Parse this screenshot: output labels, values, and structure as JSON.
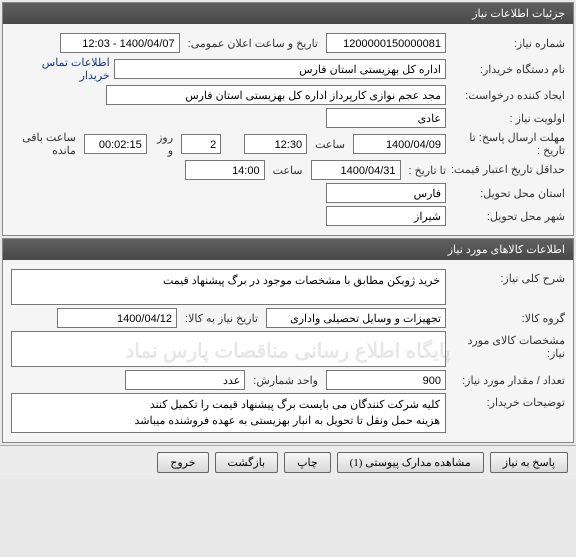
{
  "panel1": {
    "title": "جزئیات اطلاعات نیاز",
    "need_number_label": "شماره نیاز:",
    "need_number": "1200000150000081",
    "pub_datetime_label": "تاریخ و ساعت اعلان عمومی:",
    "pub_datetime": "1400/04/07 - 12:03",
    "buyer_org_label": "نام دستگاه خریدار:",
    "buyer_org": "اداره کل بهزیستی استان فارس",
    "contact_link": "اطلاعات تماس خریدار",
    "requester_label": "ایجاد کننده درخواست:",
    "requester": "مجد عجم نوازی کارپرداز اداره کل بهزیستی استان فارس",
    "priority_label": "اولویت نیاز :",
    "priority": "عادی",
    "deadline_label": "مهلت ارسال پاسخ:",
    "to_date_label": "تا تاریخ :",
    "deadline_date": "1400/04/09",
    "time_label": "ساعت",
    "deadline_time": "12:30",
    "days_value": "2",
    "days_label": "روز و",
    "countdown": "00:02:15",
    "remaining_label": "ساعت باقی مانده",
    "validity_label": "حداقل تاریخ اعتبار قیمت:",
    "validity_date": "1400/04/31",
    "validity_time": "14:00",
    "province_label": "استان محل تحویل:",
    "province": "فارس",
    "city_label": "شهر محل تحویل:",
    "city": "شیراز"
  },
  "panel2": {
    "title": "اطلاعات کالاهای مورد نیاز",
    "watermark": "پایگاه اطلاع رسانی مناقصات پارس نماد",
    "desc_label": "شرح کلی نیاز:",
    "desc": "خرید ژوبکن مطابق با مشخصات موجود در برگ پیشنهاد قیمت",
    "group_label": "گروه کالا:",
    "group": "تجهیزات و وسایل تحصیلی واداری",
    "need_by_label": "تاریخ نیاز به کالا:",
    "need_by": "1400/04/12",
    "specs_label": "مشخصات کالای مورد نیاز:",
    "specs": "",
    "qty_label": "تعداد / مقدار مورد نیاز:",
    "qty": "900",
    "unit_label": "واحد شمارش:",
    "unit": "عدد",
    "notes_label": "توضیحات خریدار:",
    "notes": "کلیه شرکت کنندگان می بایست برگ پیشنهاد قیمت را تکمیل کنند\nهزینه حمل ونقل تا تحویل به انبار بهزیستی به عهده فروشنده میباشد"
  },
  "buttons": {
    "respond": "پاسخ به نیاز",
    "attachments": "مشاهده مدارک پیوستی  (1)",
    "print": "چاپ",
    "return": "بازگشت",
    "exit": "خروج"
  }
}
